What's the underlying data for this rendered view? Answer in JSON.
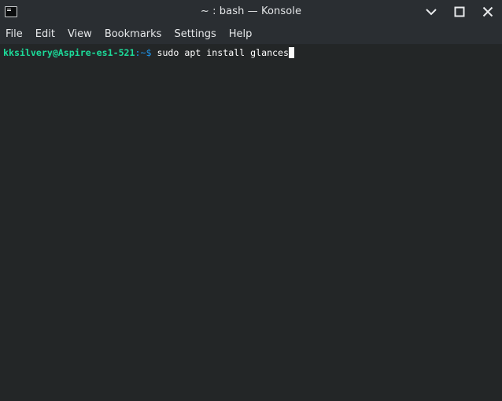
{
  "window": {
    "title": "~ : bash — Konsole"
  },
  "menubar": {
    "items": [
      "File",
      "Edit",
      "View",
      "Bookmarks",
      "Settings",
      "Help"
    ]
  },
  "terminal": {
    "user_host": "kksilvery@Aspire-es1-521",
    "path_prompt": ":~$",
    "command": " sudo apt install glances"
  },
  "icons": {
    "app": "konsole-icon",
    "minimize": "minimize-icon",
    "maximize": "maximize-icon",
    "close": "close-icon"
  },
  "colors": {
    "background": "#232627",
    "titlebar": "#2a2e32",
    "prompt_user": "#1cdc9a",
    "prompt_path": "#1d99f3",
    "text": "#fcfcfc"
  }
}
